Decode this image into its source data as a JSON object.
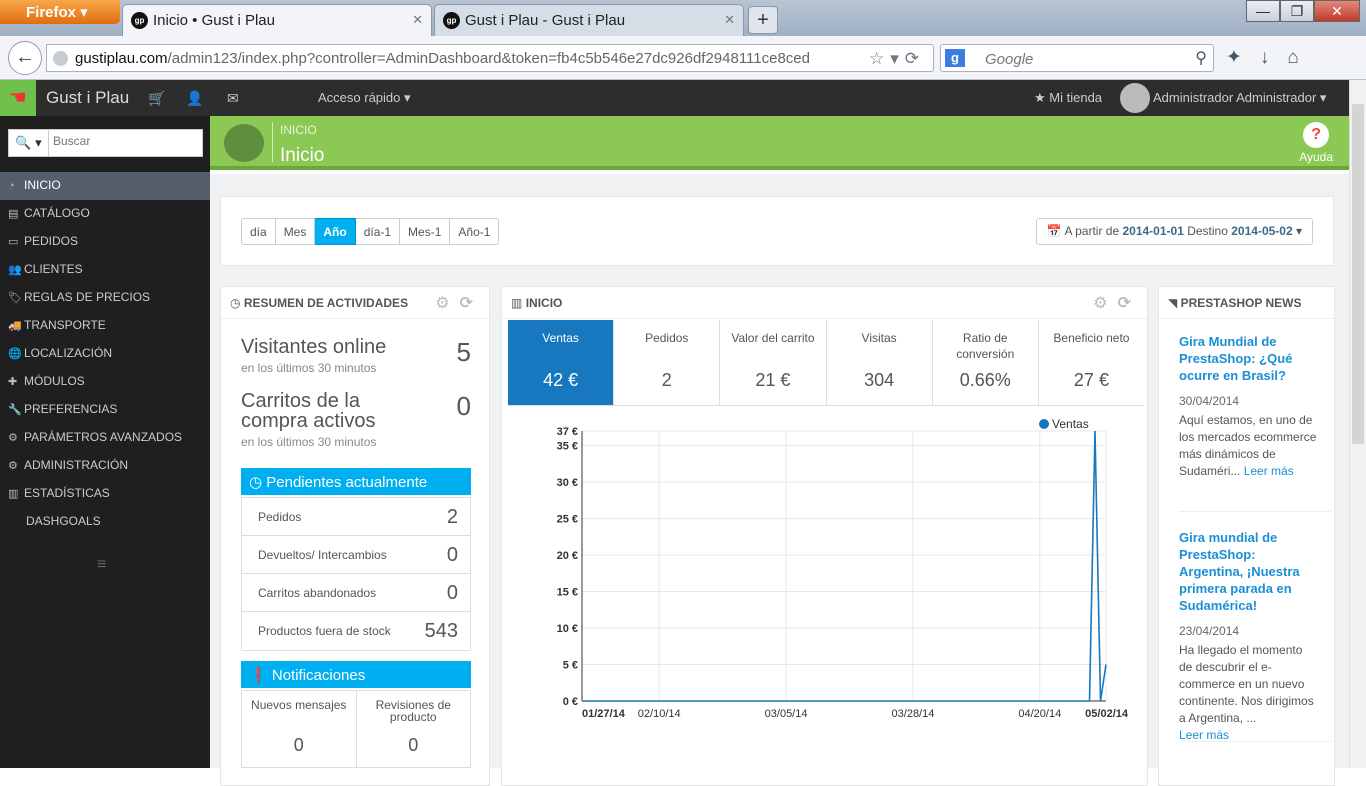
{
  "browser": {
    "menu_button": "Firefox",
    "tabs": [
      {
        "title": "Inicio • Gust i Plau",
        "active": true
      },
      {
        "title": "Gust i Plau - Gust i Plau",
        "active": false
      }
    ],
    "url_host": "gustiplau.com",
    "url_path": "/admin123/index.php?controller=AdminDashboard&token=fb4c5b546e27dc926df2948111ce8ced",
    "search_placeholder": "Google"
  },
  "topbar": {
    "shop_name": "Gust i Plau",
    "quick_access": "Acceso rápido",
    "my_shop": "Mi tienda",
    "user": "Administrador Administrador"
  },
  "sidebar": {
    "search_placeholder": "Buscar",
    "items": [
      {
        "label": "INICIO",
        "icon": "dashboard-icon",
        "active": true
      },
      {
        "label": "CATÁLOGO",
        "icon": "book-icon"
      },
      {
        "label": "PEDIDOS",
        "icon": "credit-card-icon"
      },
      {
        "label": "CLIENTES",
        "icon": "users-icon"
      },
      {
        "label": "REGLAS DE PRECIOS",
        "icon": "tags-icon"
      },
      {
        "label": "TRANSPORTE",
        "icon": "truck-icon"
      },
      {
        "label": "LOCALIZACIÓN",
        "icon": "globe-icon"
      },
      {
        "label": "MÓDULOS",
        "icon": "puzzle-icon"
      },
      {
        "label": "PREFERENCIAS",
        "icon": "wrench-icon"
      },
      {
        "label": "PARÁMETROS AVANZADOS",
        "icon": "cogs-icon"
      },
      {
        "label": "ADMINISTRACIÓN",
        "icon": "cog-icon"
      },
      {
        "label": "ESTADÍSTICAS",
        "icon": "bar-chart-icon"
      },
      {
        "label": "DASHGOALS",
        "icon": ""
      }
    ]
  },
  "page": {
    "breadcrumb": "INICIO",
    "title": "Inicio",
    "help": "Ayuda"
  },
  "filters": {
    "periods": [
      "día",
      "Mes",
      "Año",
      "día-1",
      "Mes-1",
      "Año-1"
    ],
    "active_period": "Año",
    "from_label": "A partir de",
    "from_date": "2014-01-01",
    "to_label": "Destino",
    "to_date": "2014-05-02"
  },
  "activity": {
    "title": "RESUMEN DE ACTIVIDADES",
    "visitors_label": "Visitantes online",
    "visitors_value": "5",
    "visitors_sub": "en los últimos 30 minutos",
    "carts_label": "Carritos de la compra activos",
    "carts_value": "0",
    "carts_sub": "en los últimos 30 minutos",
    "pending_title": "Pendientes actualmente",
    "pending": [
      {
        "label": "Pedidos",
        "value": "2"
      },
      {
        "label": "Devueltos/ Intercambios",
        "value": "0"
      },
      {
        "label": "Carritos abandonados",
        "value": "0"
      },
      {
        "label": "Productos fuera de stock",
        "value": "543"
      }
    ],
    "notif_title": "Notificaciones",
    "notifications": [
      {
        "label": "Nuevos mensajes",
        "value": "0"
      },
      {
        "label": "Revisiones de producto",
        "value": "0"
      }
    ]
  },
  "dashboard": {
    "title": "INICIO",
    "kpis": [
      {
        "label": "Ventas",
        "value": "42 €",
        "selected": true
      },
      {
        "label": "Pedidos",
        "value": "2"
      },
      {
        "label": "Valor del carrito",
        "value": "21 €"
      },
      {
        "label": "Visitas",
        "value": "304"
      },
      {
        "label": "Ratio de conversión",
        "value": "0.66%"
      },
      {
        "label": "Beneficio neto",
        "value": "27 €"
      }
    ]
  },
  "chart_data": {
    "type": "line",
    "series": [
      {
        "name": "Ventas",
        "color": "#1778c0",
        "points": [
          [
            "01/27/14",
            0
          ],
          [
            "04/29/14",
            0
          ],
          [
            "04/30/14",
            37
          ],
          [
            "05/01/14",
            0
          ],
          [
            "05/01/14",
            0
          ],
          [
            "05/02/14",
            5
          ]
        ]
      }
    ],
    "y_ticks": [
      "0 €",
      "5 €",
      "10 €",
      "15 €",
      "20 €",
      "25 €",
      "30 €",
      "35 €",
      "37 €"
    ],
    "x_ticks": [
      "01/27/14",
      "02/10/14",
      "03/05/14",
      "03/28/14",
      "04/20/14",
      "05/02/14"
    ],
    "ylim": [
      0,
      37
    ],
    "grid": true,
    "legend_position": "top-right"
  },
  "news": {
    "title": "PRESTASHOP NEWS",
    "items": [
      {
        "title": "Gira Mundial de PrestaShop: ¿Qué ocurre en Brasil?",
        "date": "30/04/2014",
        "body": "Aquí estamos, en uno de los mercados ecommerce más dinámicos de Sudaméri...",
        "more": "Leer más"
      },
      {
        "title": "Gira mundial de PrestaShop: Argentina, ¡Nuestra primera parada en Sudamérica!",
        "date": "23/04/2014",
        "body": "Ha llegado el momento de descubrir el e-commerce en un nuevo continente. Nos dirigimos a Argentina, ...",
        "more": "Leer más"
      }
    ]
  }
}
